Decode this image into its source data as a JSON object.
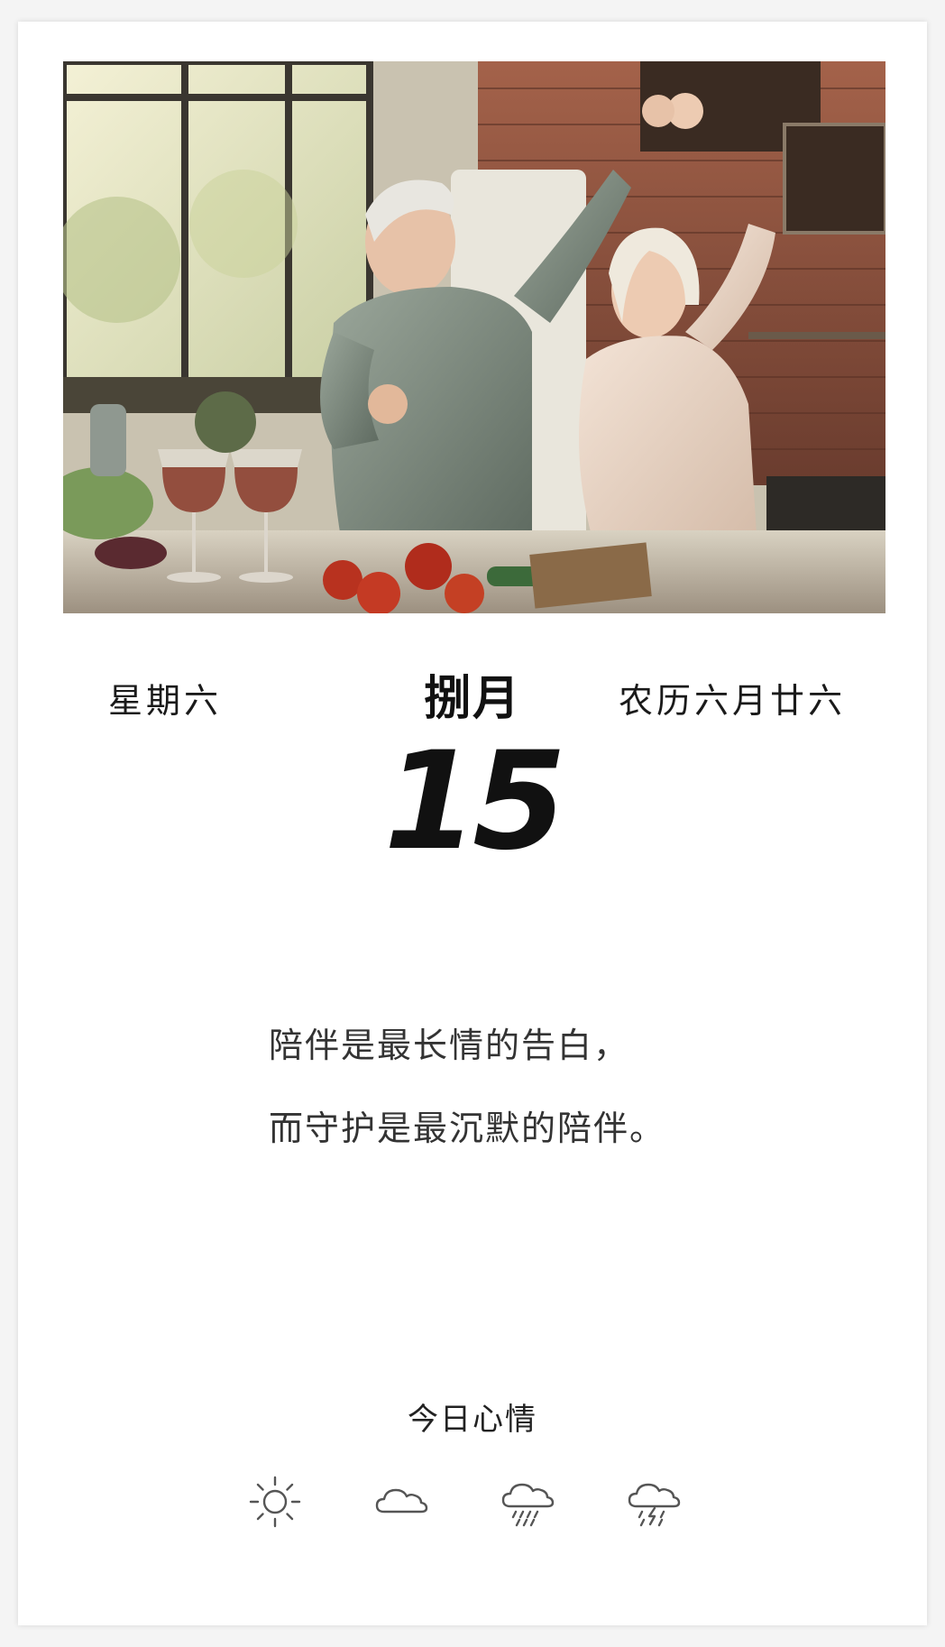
{
  "calendar": {
    "weekday": "星期六",
    "month": "捌月",
    "day": "15",
    "lunar_date": "农历六月廿六"
  },
  "quote": {
    "line1": "陪伴是最长情的告白，",
    "line2": "而守护是最沉默的陪伴。"
  },
  "mood": {
    "title": "今日心情",
    "options": [
      {
        "icon": "sun-icon"
      },
      {
        "icon": "cloud-icon"
      },
      {
        "icon": "rain-cloud-icon"
      },
      {
        "icon": "thunderstorm-cloud-icon"
      }
    ]
  },
  "colors": {
    "background": "#ffffff",
    "text": "#1a1a1a",
    "icon_stroke": "#555555"
  }
}
